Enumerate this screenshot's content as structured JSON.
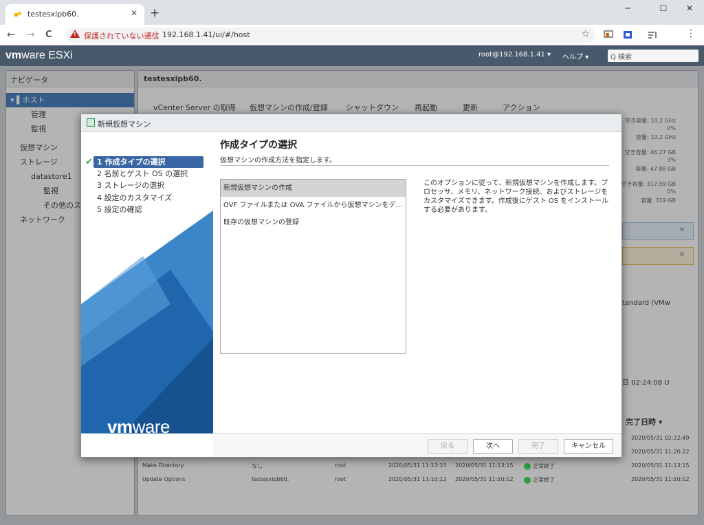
{
  "browser": {
    "tab_title": "testesxipb60.",
    "tab_close": "✕",
    "new_tab": "+",
    "win_min": "─",
    "win_max": "☐",
    "win_close": "✕",
    "back": "←",
    "forward": "→",
    "reload": "C",
    "security_text": "保護されていない通信",
    "url": "192.168.1.41/ui/#/host",
    "sep": "|",
    "star": "☆",
    "menu": "⋮"
  },
  "esxi": {
    "logo_vm": "vm",
    "logo_ware": "ware",
    "logo_product": " ESXi",
    "user": "root@192.168.1.41 ▾",
    "help": "ヘルプ ▾",
    "search_placeholder": "Q 検索"
  },
  "navigator": {
    "title": "ナビゲータ",
    "items": [
      {
        "label": "▾ ▌ホスト"
      },
      {
        "label": "管理"
      },
      {
        "label": "監視"
      },
      {
        "label": "仮想マシン"
      },
      {
        "label": "ストレージ"
      },
      {
        "label": "datastore1"
      },
      {
        "label": "監視"
      },
      {
        "label": "その他のス"
      },
      {
        "label": "ネットワーク"
      }
    ]
  },
  "main": {
    "title": "testesxipb60.",
    "toolbar": [
      {
        "label": "vCenter Server の取得"
      },
      {
        "label": "仮想マシンの作成/登録"
      },
      {
        "label": "シャットダウン"
      },
      {
        "label": "再起動"
      },
      {
        "label": "更新"
      },
      {
        "label": "アクション"
      }
    ],
    "stats": [
      {
        "label": "空き容量: 10.2 GHz"
      },
      {
        "label": "0%"
      },
      {
        "label": "容量: 10.2 GHz"
      },
      {
        "label": "空き容量: 46.27 GB"
      },
      {
        "label": "3%"
      },
      {
        "label": "容量: 47.88 GB"
      },
      {
        "label": "空き容量: 317.59 GB"
      },
      {
        "label": "0%"
      },
      {
        "label": "容量: 319 GB"
      }
    ],
    "notice_close": "✕",
    "side_text_1": "tandard (VMw",
    "side_text_2": "目 02:24:08 U"
  },
  "tasks": {
    "completed_header": "完了日時 ▾",
    "rows": [
      {
        "task": "",
        "target": "",
        "initiator": "",
        "queued": "",
        "started": "",
        "result": "",
        "completed": "2020/05/31 02:22:49"
      },
      {
        "task": "",
        "target": "",
        "initiator": "",
        "queued": "",
        "started": "",
        "result": "",
        "completed": "2020/05/31 11:20:22"
      },
      {
        "task": "",
        "target": "",
        "initiator": "",
        "queued": "",
        "started": "",
        "result": "",
        "completed": "2020/05/31 11:13:15"
      },
      {
        "task": "Make Directory",
        "target": "なし",
        "initiator": "root",
        "queued": "2020/05/31 11:13:15",
        "started": "2020/05/31 11:13:15",
        "result": "正常終了",
        "completed": "2020/05/31 11:13:15"
      },
      {
        "task": "Update Options",
        "target": "testesxipb60.",
        "initiator": "root",
        "queued": "2020/05/31 11:10:12",
        "started": "2020/05/31 11:10:12",
        "result": "正常終了",
        "completed": "2020/05/31 11:10:12"
      }
    ]
  },
  "dialog": {
    "title": "新規仮想マシン",
    "steps": [
      {
        "label": "1 作成タイプの選択"
      },
      {
        "label": "2 名前とゲスト OS の選択"
      },
      {
        "label": "3 ストレージの選択"
      },
      {
        "label": "4 設定のカスタマイズ"
      },
      {
        "label": "5 設定の確認"
      }
    ],
    "check": "✔",
    "logo_vm": "vm",
    "logo_ware": "ware",
    "heading": "作成タイプの選択",
    "subheading": "仮想マシンの作成方法を指定します。",
    "options": [
      {
        "label": "新規仮想マシンの作成"
      },
      {
        "label": "OVF ファイルまたは OVA ファイルから仮想マシンをデ..."
      },
      {
        "label": "既存の仮想マシンの登録"
      }
    ],
    "description": "このオプションに従って、新規仮想マシンを作成します。プロセッサ、メモリ、ネットワーク接続、およびストレージをカスタマイズできます。作成後にゲスト OS をインストールする必要があります。",
    "buttons": {
      "back": "戻る",
      "next": "次へ",
      "finish": "完了",
      "cancel": "キャンセル"
    }
  },
  "colors": {
    "esxi_header": "#48596b",
    "selection": "#3b78b8",
    "wizard_blue": "#2c6eb3",
    "success": "#2e9e45",
    "warning": "#c5221f"
  }
}
